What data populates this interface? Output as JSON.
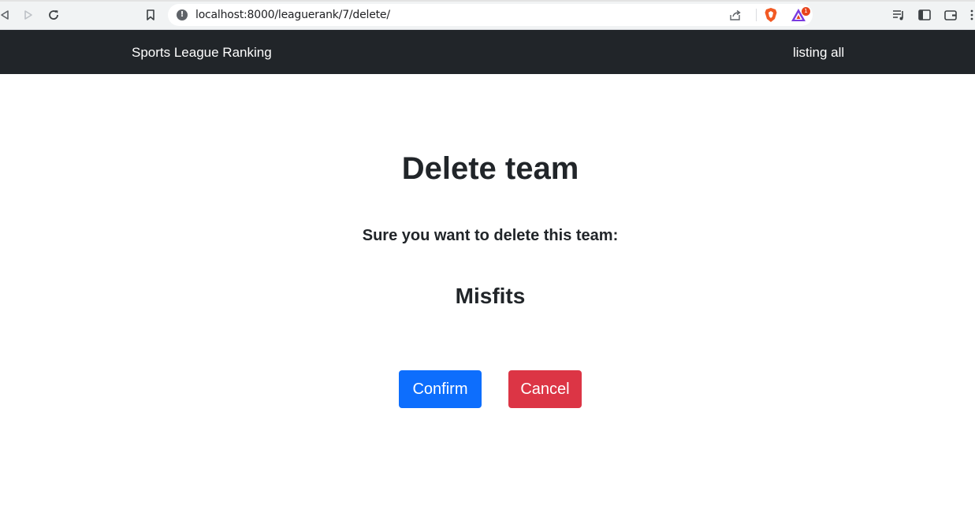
{
  "browser": {
    "url": "localhost:8000/leaguerank/7/delete/",
    "rewards_badge": "1",
    "icons": [
      "back-icon",
      "forward-icon",
      "reload-icon",
      "bookmark-icon",
      "site-info-icon",
      "share-icon",
      "brave-shields-icon",
      "brave-rewards-icon",
      "playlist-icon",
      "sidebar-icon",
      "wallet-icon",
      "menu-icon"
    ]
  },
  "navbar": {
    "brand": "Sports League Ranking",
    "link": "listing all",
    "background": "#212529"
  },
  "main": {
    "title": "Delete team",
    "prompt": "Sure you want to delete this team:",
    "team_name": "Misfits"
  },
  "actions": {
    "confirm_label": "Confirm",
    "cancel_label": "Cancel",
    "confirm_color": "#0d6efd",
    "cancel_color": "#dc3545"
  }
}
